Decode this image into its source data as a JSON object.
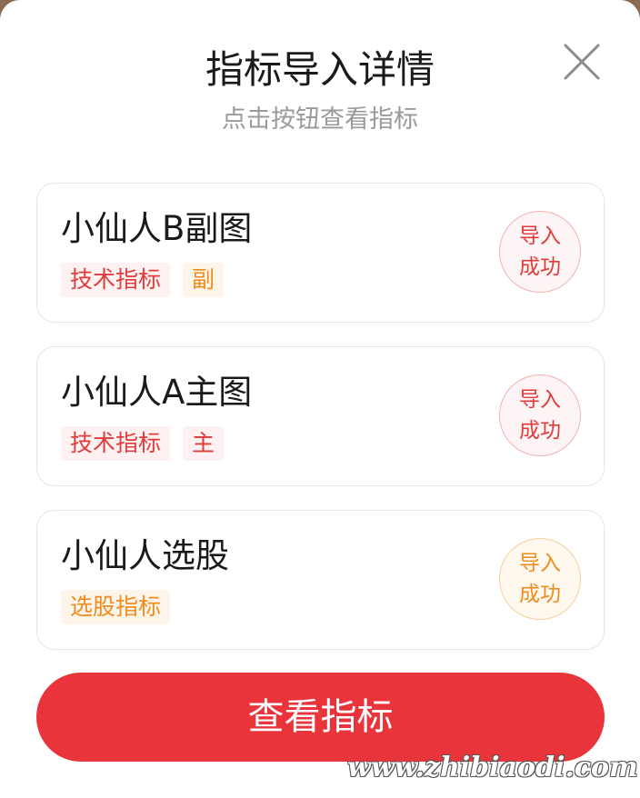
{
  "dialog": {
    "title": "指标导入详情",
    "subtitle": "点击按钮查看指标",
    "close_icon": "close-icon"
  },
  "cards": [
    {
      "name": "小仙人B副图",
      "tags": [
        {
          "label": "技术指标",
          "color": "#e23b3b"
        },
        {
          "label": "副",
          "color": "#f08c1e"
        }
      ],
      "status_line1": "导入",
      "status_line2": "成功",
      "status_color": "#e23b3b"
    },
    {
      "name": "小仙人A主图",
      "tags": [
        {
          "label": "技术指标",
          "color": "#e23b3b"
        },
        {
          "label": "主",
          "color": "#e23b3b"
        }
      ],
      "status_line1": "导入",
      "status_line2": "成功",
      "status_color": "#e23b3b"
    },
    {
      "name": "小仙人选股",
      "tags": [
        {
          "label": "选股指标",
          "color": "#f08c1e"
        }
      ],
      "status_line1": "导入",
      "status_line2": "成功",
      "status_color": "#f08c1e"
    }
  ],
  "button": {
    "label": "查看指标",
    "color": "#e8343a"
  },
  "watermark": "www.zhibiaodi.com"
}
